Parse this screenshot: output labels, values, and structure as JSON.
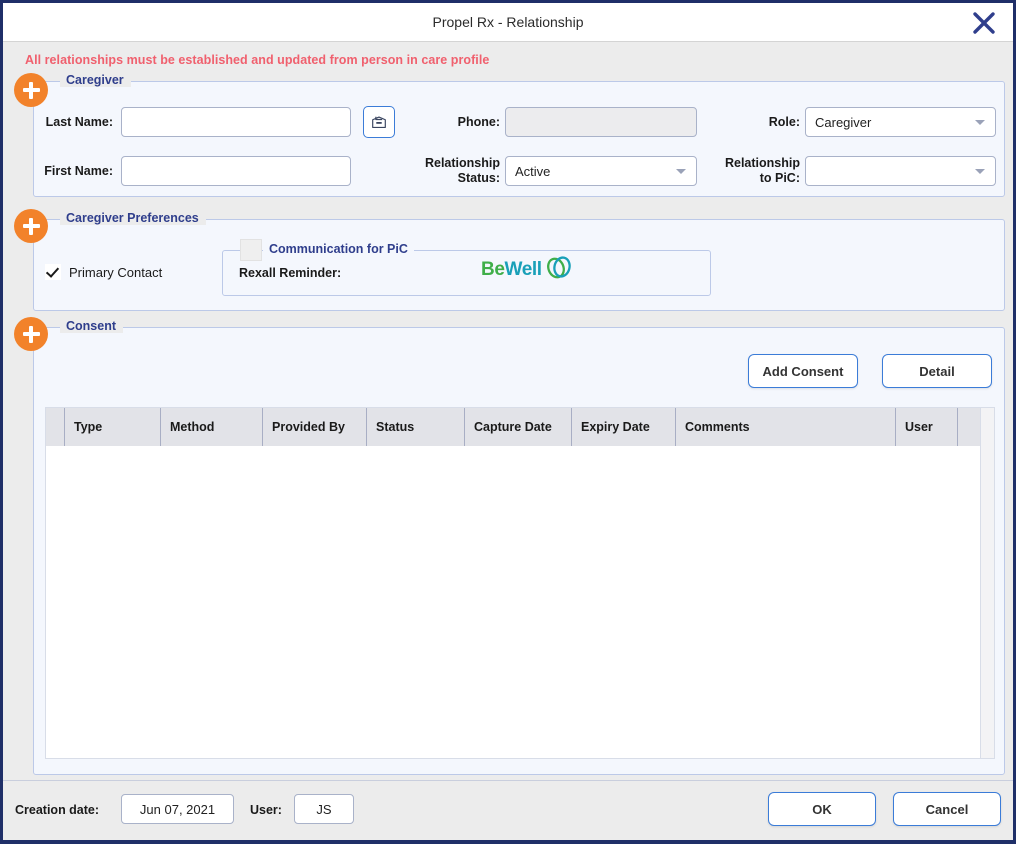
{
  "window": {
    "title": "Propel Rx - Relationship",
    "close_icon": "close-icon"
  },
  "warning": "All relationships must be established and updated from person in care profile",
  "sections": {
    "caregiver": {
      "legend": "Caregiver",
      "expand_icon": "plus-icon",
      "fields": {
        "last_name_label": "Last Name:",
        "last_name_value": "",
        "first_name_label": "First Name:",
        "first_name_value": "",
        "lookup_icon": "address-book-icon",
        "phone_label": "Phone:",
        "phone_value": "",
        "relationship_status_label": "Relationship Status:",
        "relationship_status_value": "Active",
        "role_label": "Role:",
        "role_value": "Caregiver",
        "relationship_to_pic_label": "Relationship to PiC:",
        "relationship_to_pic_value": ""
      }
    },
    "caregiver_preferences": {
      "legend": "Caregiver Preferences",
      "expand_icon": "plus-icon",
      "primary_contact_label": "Primary Contact",
      "primary_contact_checked": true,
      "communication": {
        "legend": "Communication for PiC",
        "enabled": false,
        "rexall_reminder_label": "Rexall Reminder:",
        "logo_be": "Be",
        "logo_well": "Well"
      }
    },
    "consent": {
      "legend": "Consent",
      "expand_icon": "plus-icon",
      "add_consent_label": "Add Consent",
      "detail_label": "Detail",
      "table": {
        "columns": [
          "",
          "Type",
          "Method",
          "Provided By",
          "Status",
          "Capture Date",
          "Expiry Date",
          "Comments",
          "User"
        ],
        "rows": []
      }
    }
  },
  "footer": {
    "creation_date_label": "Creation date:",
    "creation_date_value": "Jun 07, 2021",
    "user_label": "User:",
    "user_value": "JS",
    "ok_label": "OK",
    "cancel_label": "Cancel"
  },
  "colors": {
    "dialog_border": "#1f2f68",
    "accent_orange": "#f2822a",
    "legend_blue": "#2f3e8c",
    "warning_red": "#f0606e",
    "button_border": "#3b7cd8",
    "panel_bg": "#f4f7fd",
    "chrome_bg": "#ececec",
    "logo_green": "#3fae49",
    "logo_teal": "#19a0b8"
  }
}
